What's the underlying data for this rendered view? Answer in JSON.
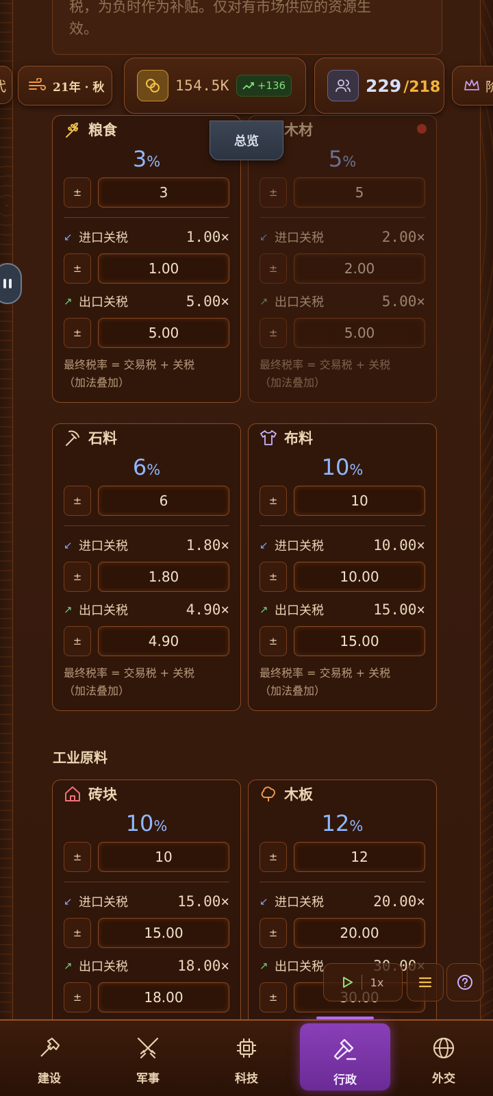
{
  "note": {
    "line1": "税，为负时作为补贴。仅对有市场供应的资源生",
    "line2": "效。"
  },
  "topbar": {
    "edge_label": "代",
    "date": "21年 · 秋",
    "money": "154.5K",
    "money_delta": "+136",
    "population": "229",
    "population_max": "/218",
    "crown_label": "阶"
  },
  "overview_tab": "总览",
  "labels": {
    "import": "进口关税",
    "export": "出口关税",
    "formula_line1": "最终税率 = 交易税 + 关税",
    "formula_line2": "（加法叠加）",
    "pm": "±",
    "pct": "%"
  },
  "cards": [
    {
      "name": "粮食",
      "rate": "3",
      "rate_input": "3",
      "import_mult": "1.00×",
      "import_input": "1.00",
      "export_mult": "5.00×",
      "export_input": "5.00"
    },
    {
      "name": "木材",
      "rate": "5",
      "rate_input": "5",
      "import_mult": "2.00×",
      "import_input": "2.00",
      "export_mult": "5.00×",
      "export_input": "5.00"
    },
    {
      "name": "石料",
      "rate": "6",
      "rate_input": "6",
      "import_mult": "1.80×",
      "import_input": "1.80",
      "export_mult": "4.90×",
      "export_input": "4.90"
    },
    {
      "name": "布料",
      "rate": "10",
      "rate_input": "10",
      "import_mult": "10.00×",
      "import_input": "10.00",
      "export_mult": "15.00×",
      "export_input": "15.00"
    },
    {
      "name": "砖块",
      "rate": "10",
      "rate_input": "10",
      "import_mult": "15.00×",
      "import_input": "15.00",
      "export_mult": "18.00×",
      "export_input": "18.00"
    },
    {
      "name": "木板",
      "rate": "12",
      "rate_input": "12",
      "import_mult": "20.00×",
      "import_input": "20.00",
      "export_mult": "30.00×",
      "export_input": "30.00"
    }
  ],
  "section_industrial": "工业原料",
  "speed": "1x",
  "nav": [
    {
      "label": "建设"
    },
    {
      "label": "军事"
    },
    {
      "label": "科技"
    },
    {
      "label": "行政"
    },
    {
      "label": "外交"
    }
  ],
  "colors": {
    "accent_blue": "#8fb8ff",
    "active_nav": "#8a3fb8",
    "gold": "#f0b43a"
  }
}
